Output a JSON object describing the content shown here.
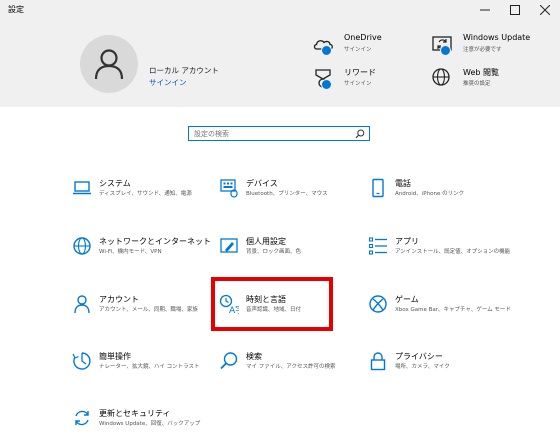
{
  "window": {
    "title": "設定"
  },
  "account": {
    "name": "ローカル アカウント",
    "signin": "サインイン"
  },
  "header_items": [
    {
      "title": "OneDrive",
      "sub": "サインイン",
      "icon": "onedrive-icon"
    },
    {
      "title": "Windows Update",
      "sub": "注意が必要です",
      "icon": "windows-update-icon"
    },
    {
      "title": "リワード",
      "sub": "サインイン",
      "icon": "rewards-icon"
    },
    {
      "title": "Web 閲覧",
      "sub": "推奨の設定",
      "icon": "web-browsing-icon"
    }
  ],
  "search": {
    "placeholder": "設定の検索"
  },
  "categories": [
    {
      "title": "システム",
      "sub": "ディスプレイ、サウンド、通知、電源",
      "icon": "laptop-icon"
    },
    {
      "title": "デバイス",
      "sub": "Bluetooth、プリンター、マウス",
      "icon": "keyboard-icon"
    },
    {
      "title": "電話",
      "sub": "Android、iPhone のリンク",
      "icon": "phone-icon"
    },
    {
      "title": "ネットワークとインターネット",
      "sub": "Wi-Fi、機内モード、VPN",
      "icon": "globe-icon"
    },
    {
      "title": "個人用設定",
      "sub": "背景、ロック画面、色",
      "icon": "paint-icon"
    },
    {
      "title": "アプリ",
      "sub": "アンインストール、既定値、オプションの機能",
      "icon": "apps-list-icon"
    },
    {
      "title": "アカウント",
      "sub": "アカウント、メール、同期、職場、家族",
      "icon": "person-icon"
    },
    {
      "title": "時刻と言語",
      "sub": "音声認識、地域、日付",
      "icon": "time-language-icon"
    },
    {
      "title": "ゲーム",
      "sub": "Xbox Game Bar、キャプチャ、ゲーム モード",
      "icon": "xbox-icon"
    },
    {
      "title": "簡単操作",
      "sub": "ナレーター、拡大鏡、ハイ コントラスト",
      "icon": "ease-of-access-icon"
    },
    {
      "title": "検索",
      "sub": "マイ ファイル、アクセス許可の検索",
      "icon": "search-icon"
    },
    {
      "title": "プライバシー",
      "sub": "場所、カメラ、マイク",
      "icon": "lock-icon"
    },
    {
      "title": "更新とセキュリティ",
      "sub": "Windows Update、回復、バックアップ",
      "icon": "sync-icon"
    }
  ],
  "colors": {
    "accent": "#0078d7",
    "header_bg": "#f0f0f0",
    "highlight": "#e60000"
  }
}
